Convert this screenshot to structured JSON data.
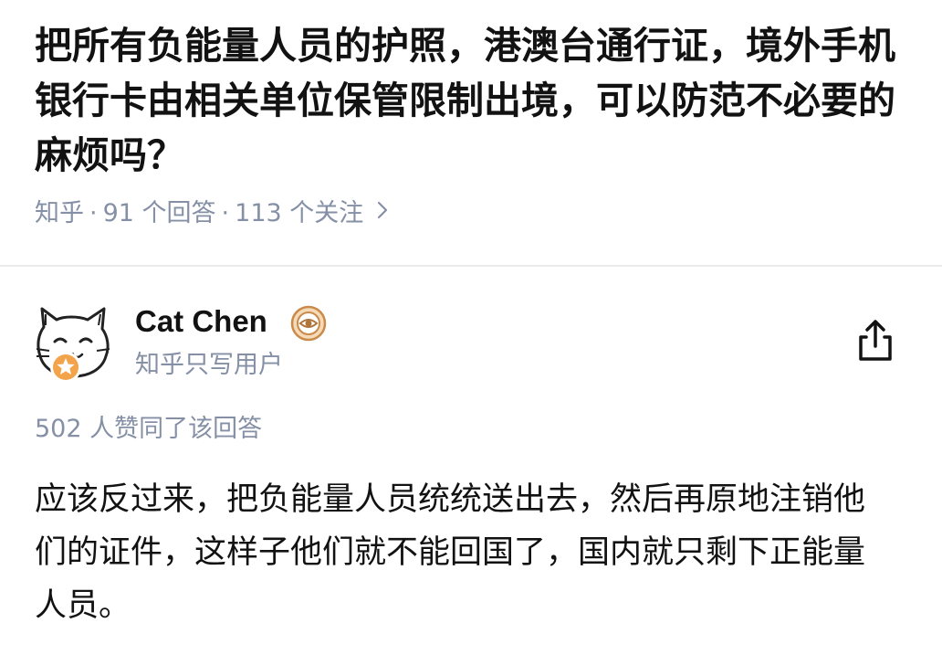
{
  "question": {
    "title": "把所有负能量人员的护照，港澳台通行证，境外手机银行卡由相关单位保管限制出境，可以防范不必要的麻烦吗？",
    "source": "知乎",
    "separator": "·",
    "answer_count": "91 个回答",
    "follower_count": "113 个关注",
    "chevron_icon": "chevron-right-icon"
  },
  "answer": {
    "author_name": "Cat Chen",
    "author_headline": "知乎只写用户",
    "author_badge_icon": "eye-badge-icon",
    "avatar_icon": "cat-avatar",
    "avatar_level_icon": "star-badge-icon",
    "share_icon": "share-icon",
    "vote_text": "502 人赞同了该回答",
    "content": "应该反过来，把负能量人员统统送出去，然后再原地注销他们的证件，这样子他们就不能回国了，国内就只剩下正能量人员。"
  },
  "colors": {
    "text_primary": "#121212",
    "text_secondary": "#8590a6",
    "divider": "#ebebeb",
    "badge_orange": "#f3a34a",
    "badge_ring": "#c98a4b"
  }
}
